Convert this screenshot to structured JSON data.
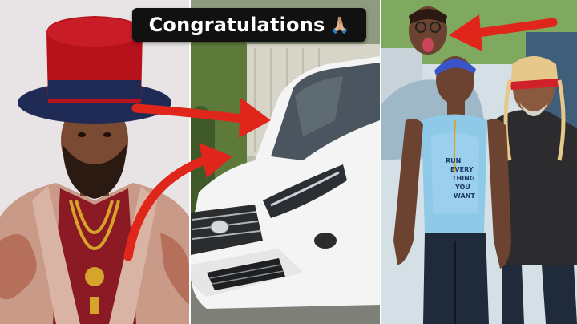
{
  "caption": {
    "text": "Congratulations",
    "emoji": "🙏🏼"
  },
  "shirt_text": [
    "RUN",
    "EVERY",
    "THING",
    "YOU",
    "WANT"
  ],
  "colors": {
    "arrow": "#e0261b",
    "caption_bg": "#111111",
    "caption_text": "#ffffff",
    "top_hat": "#b5121b",
    "car_body": "#f4f4f4",
    "tank_top": "#8fc9e8"
  },
  "icons": [
    "praying-hands-emoji",
    "toyota-logo"
  ]
}
